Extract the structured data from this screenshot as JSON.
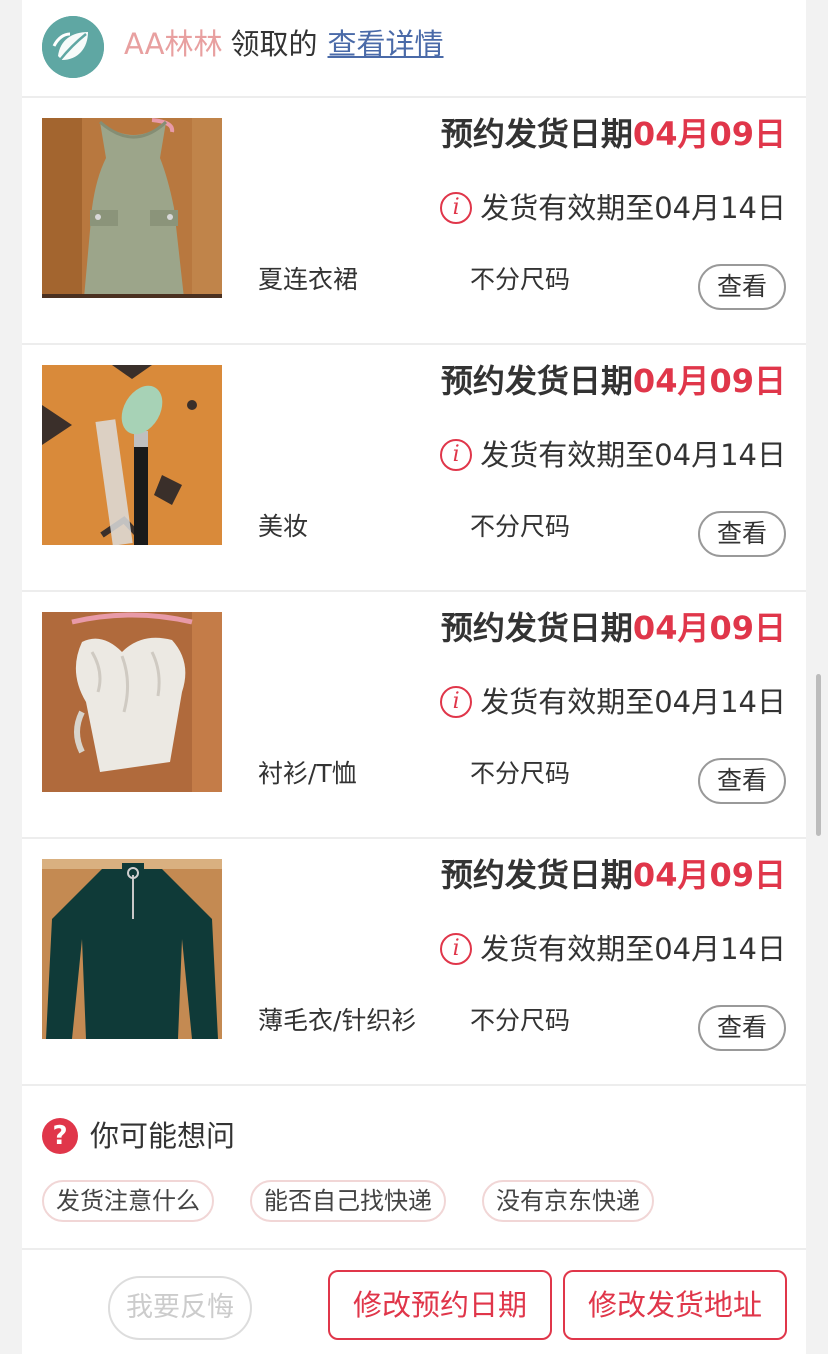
{
  "header": {
    "name": "AA林林",
    "action": "领取的",
    "link": "查看详情",
    "avatar_icon": "leaf-logo-icon"
  },
  "items": [
    {
      "thumb": "green-dress-photo",
      "ship_prefix": "预约发货日期",
      "ship_date": "04月09日",
      "valid_text": "发货有效期至04月14日",
      "category": "夏连衣裙",
      "size": "不分尺码",
      "view_label": "查看"
    },
    {
      "thumb": "makeup-brush-photo",
      "ship_prefix": "预约发货日期",
      "ship_date": "04月09日",
      "valid_text": "发货有效期至04月14日",
      "category": "美妆",
      "size": "不分尺码",
      "view_label": "查看"
    },
    {
      "thumb": "white-ruffle-blouse-photo",
      "ship_prefix": "预约发货日期",
      "ship_date": "04月09日",
      "valid_text": "发货有效期至04月14日",
      "category": "衬衫/T恤",
      "size": "不分尺码",
      "view_label": "查看"
    },
    {
      "thumb": "dark-green-sweater-photo",
      "ship_prefix": "预约发货日期",
      "ship_date": "04月09日",
      "valid_text": "发货有效期至04月14日",
      "category": "薄毛衣/针织衫",
      "size": "不分尺码",
      "view_label": "查看"
    }
  ],
  "faq": {
    "icon": "question-icon",
    "icon_glyph": "?",
    "title": "你可能想问",
    "chips": [
      "发货注意什么",
      "能否自己找快递",
      "没有京东快递"
    ]
  },
  "footer": {
    "regret_label": "我要反悔",
    "change_date_label": "修改预约日期",
    "change_address_label": "修改发货地址"
  },
  "colors": {
    "accent_red": "#e0364a",
    "link_blue": "#4a6aa8",
    "name_pink": "#e8a0a0",
    "avatar_teal": "#5fa7a3"
  }
}
